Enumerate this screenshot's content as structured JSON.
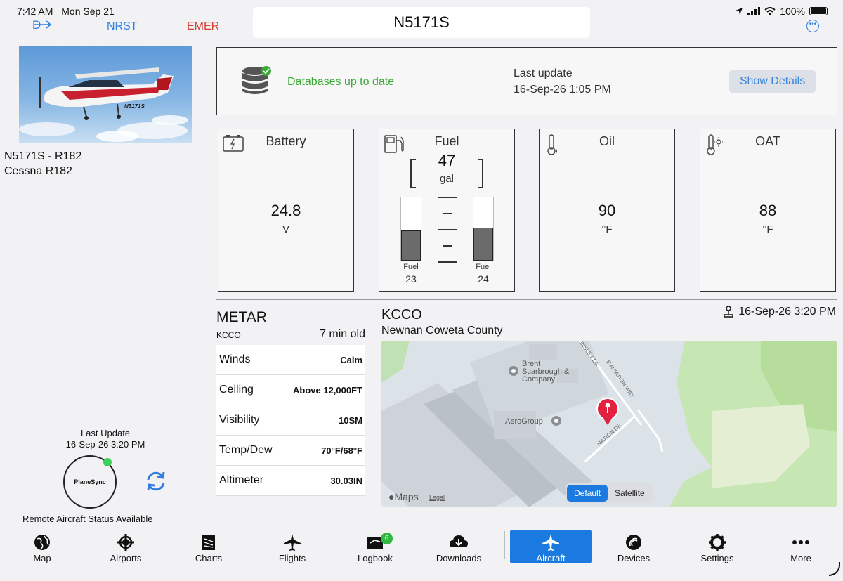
{
  "status_bar": {
    "time": "7:42 AM",
    "date": "Mon Sep 21",
    "battery": "100%"
  },
  "nav": {
    "direct_icon": "direct-to-icon",
    "nrst": "NRST",
    "emer": "EMER",
    "tail": "N5171S",
    "more_icon": "ellipsis-circle-icon"
  },
  "aircraft": {
    "line1": "N5171S  -  R182",
    "line2": "Cessna  R182",
    "photo_label": "N5171S"
  },
  "sync": {
    "update_label": "Last Update",
    "update_time": "16-Sep-26 3:20 PM",
    "device": "PlaneSync",
    "remote_status": "Remote Aircraft Status Available",
    "colors": {
      "online": "#3cd25a"
    }
  },
  "database": {
    "status": "Databases up to date",
    "last_update_label": "Last update",
    "last_update_value": "16-Sep-26 1:05 PM",
    "show_details": "Show Details"
  },
  "gauges": {
    "battery": {
      "title": "Battery",
      "value": "24.8",
      "unit": "V"
    },
    "fuel": {
      "title": "Fuel",
      "total": "47",
      "unit": "gal",
      "left": {
        "label": "Fuel",
        "value": "23",
        "level": 0.48
      },
      "right": {
        "label": "Fuel",
        "value": "24",
        "level": 0.52
      }
    },
    "oil": {
      "title": "Oil",
      "value": "90",
      "unit": "°F"
    },
    "oat": {
      "title": "OAT",
      "value": "88",
      "unit": "°F"
    }
  },
  "metar": {
    "title": "METAR",
    "station": "KCCO",
    "age": "7 min old",
    "rows": [
      {
        "label": "Winds",
        "value": "Calm"
      },
      {
        "label": "Ceiling",
        "value": "Above 12,000FT"
      },
      {
        "label": "Visibility",
        "value": "10SM"
      },
      {
        "label": "Temp/Dew",
        "value": "70°F/68°F"
      },
      {
        "label": "Altimeter",
        "value": "30.03IN"
      }
    ]
  },
  "map": {
    "station": "KCCO",
    "airport_name": "Newnan Coweta County",
    "time": "16-Sep-26 3:20 PM",
    "pois": [
      "Brent Scarbrough & Company",
      "AeroGroup"
    ],
    "roads": [
      "INSLEY DR",
      "E AVIATION WAY",
      "NATION DR"
    ],
    "attribution": "Maps",
    "legal": "Legal",
    "modes": [
      "Default",
      "Satellite"
    ],
    "active_mode": "Default"
  },
  "tabs": [
    {
      "label": "Map",
      "icon": "globe-icon"
    },
    {
      "label": "Airports",
      "icon": "airport-icon"
    },
    {
      "label": "Charts",
      "icon": "charts-icon"
    },
    {
      "label": "Flights",
      "icon": "plane-icon"
    },
    {
      "label": "Logbook",
      "icon": "logbook-icon",
      "badge": "6"
    },
    {
      "label": "Downloads",
      "icon": "cloud-download-icon"
    },
    {
      "label": "Aircraft",
      "icon": "aircraft-icon",
      "active": true
    },
    {
      "label": "Devices",
      "icon": "devices-icon"
    },
    {
      "label": "Settings",
      "icon": "gear-icon"
    },
    {
      "label": "More",
      "icon": "more-icon"
    }
  ],
  "colors": {
    "accent": "#1a7ae0",
    "emergency": "#d2412f",
    "ok": "#3aaa35"
  }
}
